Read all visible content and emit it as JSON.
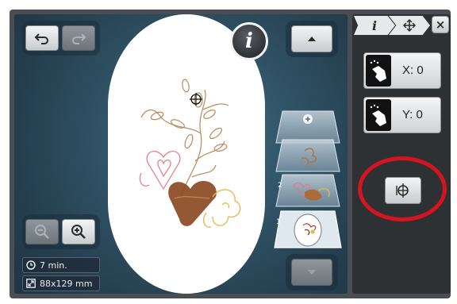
{
  "toolbar": {
    "undo_icon": "undo-arrow",
    "redo_icon": "redo-arrow"
  },
  "info_button": {
    "label": "i"
  },
  "status": {
    "time_text": "7 min.",
    "size_text": "88x129 mm"
  },
  "layers": {
    "items": [
      {
        "number": "",
        "kind": "add"
      },
      {
        "number": "",
        "kind": "flower-thumbnail"
      },
      {
        "number": "2",
        "kind": "flower-thumbnail"
      },
      {
        "number": "1",
        "kind": "selected-hoop-thumbnail"
      }
    ]
  },
  "panel": {
    "tab_info_label": "i",
    "tab_move_icon": "move-arrows",
    "close_label": "×",
    "x_label": "X: 0",
    "y_label": "Y: 0",
    "center_icon": "center-crosshair"
  },
  "colors": {
    "accent_red": "#d4141f",
    "workspace_blue": "#2f5063",
    "motif_brown": "#8b4a23",
    "motif_pink": "#e07a8a",
    "motif_gold": "#e2b84a"
  }
}
